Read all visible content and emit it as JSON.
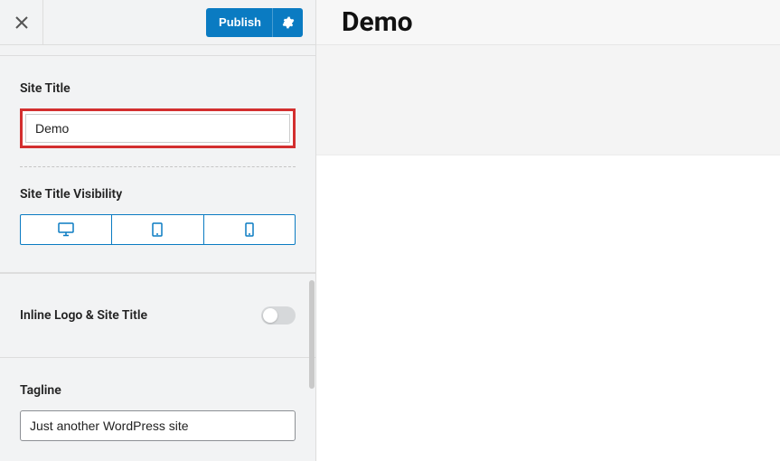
{
  "header": {
    "publish_label": "Publish"
  },
  "site_title": {
    "label": "Site Title",
    "value": "Demo"
  },
  "visibility": {
    "label": "Site Title Visibility"
  },
  "inline_logo": {
    "label": "Inline Logo & Site Title",
    "enabled": false
  },
  "tagline": {
    "label": "Tagline",
    "value": "Just another WordPress site"
  },
  "preview": {
    "title": "Demo"
  }
}
